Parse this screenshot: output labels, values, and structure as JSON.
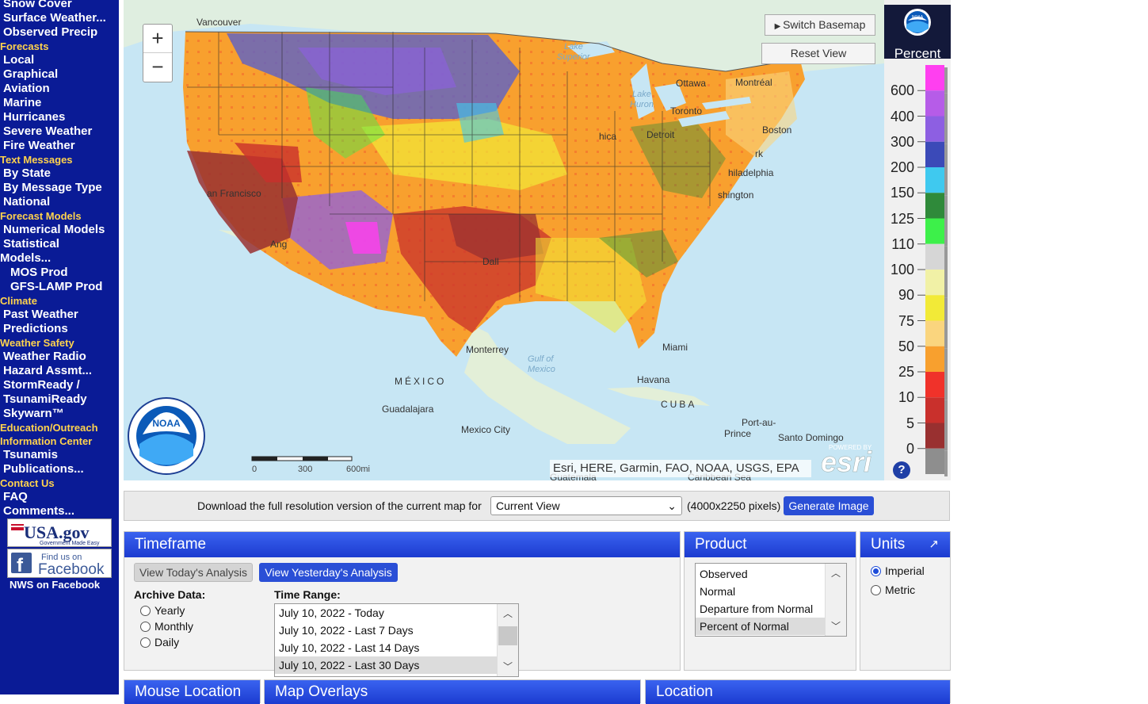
{
  "sidebar": {
    "items": [
      {
        "label": "Snow Cover",
        "type": "item"
      },
      {
        "label": "Surface Weather...",
        "type": "item"
      },
      {
        "label": "Observed Precip",
        "type": "item"
      },
      {
        "label": "Forecasts",
        "type": "head"
      },
      {
        "label": "Local",
        "type": "item"
      },
      {
        "label": "Graphical",
        "type": "item"
      },
      {
        "label": "Aviation",
        "type": "item"
      },
      {
        "label": "Marine",
        "type": "item"
      },
      {
        "label": "Hurricanes",
        "type": "item"
      },
      {
        "label": "Severe Weather",
        "type": "item"
      },
      {
        "label": "Fire Weather",
        "type": "item"
      },
      {
        "label": "Text Messages",
        "type": "head"
      },
      {
        "label": "By State",
        "type": "item"
      },
      {
        "label": "By Message Type",
        "type": "item"
      },
      {
        "label": "National",
        "type": "item"
      },
      {
        "label": "Forecast Models",
        "type": "head"
      },
      {
        "label": "Numerical Models",
        "type": "item"
      },
      {
        "label": "Statistical",
        "type": "item"
      },
      {
        "label": "Models...",
        "type": "item"
      },
      {
        "label": "MOS Prod",
        "type": "item"
      },
      {
        "label": "GFS-LAMP Prod",
        "type": "item"
      },
      {
        "label": "Climate",
        "type": "head"
      },
      {
        "label": "Past Weather",
        "type": "item"
      },
      {
        "label": "Predictions",
        "type": "item"
      },
      {
        "label": "Weather Safety",
        "type": "head"
      },
      {
        "label": "Weather Radio",
        "type": "item"
      },
      {
        "label": "Hazard Assmt...",
        "type": "item"
      },
      {
        "label": "StormReady /",
        "type": "item"
      },
      {
        "label": "TsunamiReady",
        "type": "item"
      },
      {
        "label": "Skywarn™",
        "type": "item"
      },
      {
        "label": "Education/Outreach",
        "type": "head"
      },
      {
        "label": "Information Center",
        "type": "head"
      },
      {
        "label": "Tsunamis",
        "type": "item"
      },
      {
        "label": "Publications...",
        "type": "item"
      },
      {
        "label": "Contact Us",
        "type": "head"
      },
      {
        "label": "FAQ",
        "type": "item"
      },
      {
        "label": "Comments...",
        "type": "item"
      }
    ],
    "usa_gov": {
      "main": "USA.gov",
      "tag": "Government Made Easy"
    },
    "facebook": {
      "line1": "Find us on",
      "line2": "Facebook"
    },
    "nws_facebook": "NWS on Facebook"
  },
  "map": {
    "switch_basemap": "Switch Basemap",
    "reset_view": "Reset View",
    "zoom_in": "+",
    "zoom_out": "−",
    "attribution": "Esri, HERE, Garmin, FAO, NOAA, USGS, EPA",
    "powered_by": "POWERED BY",
    "esri": "esri",
    "noaa_seal": "NOAA",
    "scale": [
      "0",
      "300",
      "600mi"
    ],
    "places": [
      "Vancouver",
      "Ottawa",
      "Montréal",
      "Toronto",
      "Detroit",
      "hica",
      "Boston",
      "rk",
      "hiladelphia",
      "shington",
      "an Francisco",
      "Ang",
      "Dall",
      "Miami",
      "Havana",
      "CUBA",
      "MÉXICO",
      "Monterrey",
      "Guadalajara",
      "Mexico City",
      "Port-au-",
      "Prince",
      "Santo Domingo",
      "Guatemala",
      "Caribbean Sea"
    ],
    "water": [
      "Lake",
      "Superior",
      "Lake",
      "Huron",
      "Gulf of",
      "Mexico"
    ]
  },
  "legend": {
    "title": "Percent",
    "noaa": "NOAA",
    "values": [
      "600",
      "400",
      "300",
      "200",
      "150",
      "125",
      "110",
      "100",
      "90",
      "75",
      "50",
      "25",
      "10",
      "5",
      "0"
    ],
    "colors": [
      "#ff3ff0",
      "#b65ce8",
      "#8d5fe2",
      "#3b4ab8",
      "#3fc9ef",
      "#2f8a3a",
      "#3df04a",
      "#d6d6d6",
      "#f1f1a6",
      "#f2ea37",
      "#fad57e",
      "#f8a02e",
      "#f0322a",
      "#c9302c",
      "#993030",
      "#8e8e8e"
    ],
    "help": "?"
  },
  "download": {
    "label": "Download the full resolution version of the current map for",
    "selected": "Current View",
    "size": "(4000x2250 pixels)",
    "button": "Generate Image"
  },
  "timeframe": {
    "title": "Timeframe",
    "today_button": "View Today's Analysis",
    "yesterday_button": "View Yesterday's Analysis",
    "archive_label": "Archive Data:",
    "archive_options": [
      "Yearly",
      "Monthly",
      "Daily"
    ],
    "range_label": "Time Range:",
    "ranges": [
      "July 10, 2022 - Today",
      "July 10, 2022 - Last 7 Days",
      "July 10, 2022 - Last 14 Days",
      "July 10, 2022 - Last 30 Days"
    ],
    "selected_range": "July 10, 2022 - Last 30 Days"
  },
  "product": {
    "title": "Product",
    "options": [
      "Observed",
      "Normal",
      "Departure from Normal",
      "Percent of Normal"
    ],
    "selected": "Percent of Normal"
  },
  "units": {
    "title": "Units",
    "options": [
      "Imperial",
      "Metric"
    ],
    "selected": "Imperial"
  },
  "bottom_panels": [
    "Mouse Location",
    "Map Overlays",
    "Location"
  ]
}
